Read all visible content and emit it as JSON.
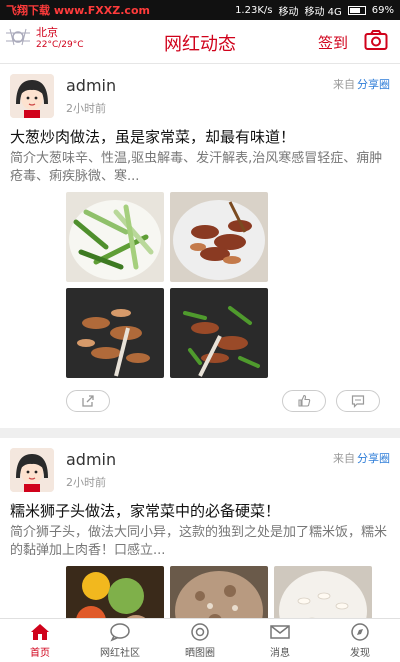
{
  "status_bar": {
    "watermark": "飞翔下载 www.FXXZ.com",
    "speed": "1.23K/s",
    "carrier1": "移动",
    "carrier2": "移动 4G",
    "battery": "69%"
  },
  "header": {
    "city": "北京",
    "temperature": "22°C/29°C",
    "title": "网红动态",
    "signin_label": "签到",
    "camera_icon": "camera-icon"
  },
  "posts": [
    {
      "user": "admin",
      "time": "2小时前",
      "source_prefix": "来自",
      "source_link": "分享圈",
      "title": "大葱炒肉做法，虽是家常菜，却最有味道！",
      "desc": "简介大葱味辛、性温,驱虫解毒、发汗解表,治风寒感冒轻症、痈肿疮毒、痢疾脉微、寒..."
    },
    {
      "user": "admin",
      "time": "2小时前",
      "source_prefix": "来自",
      "source_link": "分享圈",
      "title": "糯米狮子头做法，家常菜中的必备硬菜！",
      "desc": "简介狮子头，做法大同小异，这款的独到之处是加了糯米饭，糯米的黏弹加上肉香！口感立..."
    }
  ],
  "tabbar": {
    "tabs": [
      {
        "label": "首页",
        "icon": "home-icon"
      },
      {
        "label": "网红社区",
        "icon": "chat-icon"
      },
      {
        "label": "晒图圈",
        "icon": "camera-lens-icon"
      },
      {
        "label": "消息",
        "icon": "message-icon"
      },
      {
        "label": "发现",
        "icon": "discover-icon"
      }
    ]
  },
  "colors": {
    "accent": "#d0021b",
    "link": "#2f7ed8"
  }
}
